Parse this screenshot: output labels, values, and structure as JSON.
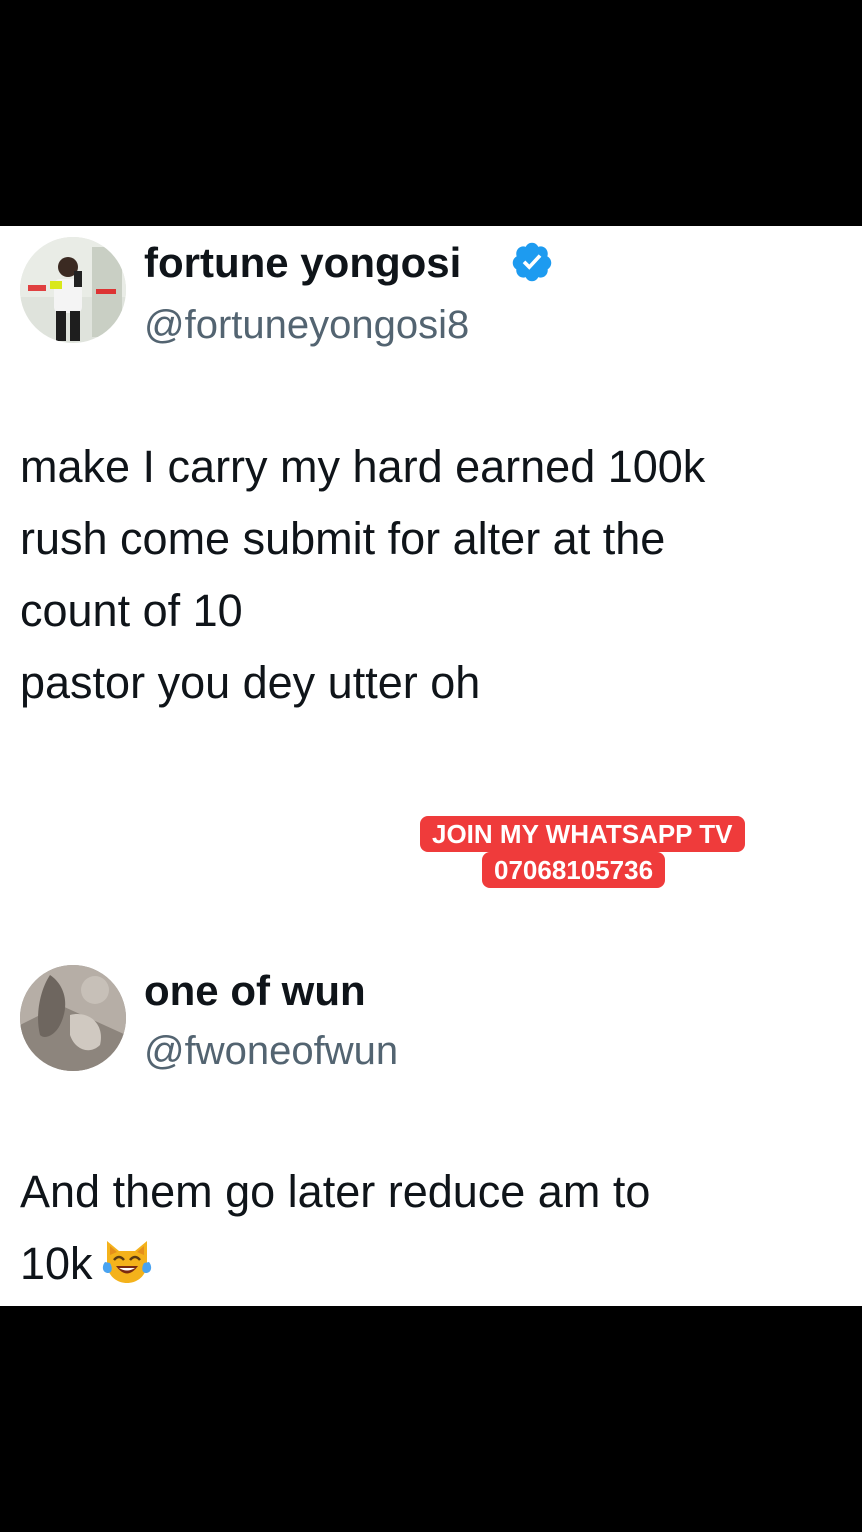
{
  "tweets": [
    {
      "display_name": "fortune yongosi",
      "handle": "@fortuneyongosi8",
      "verified": true,
      "lines": [
        "make I carry my hard earned 100k",
        "rush come submit for alter at the",
        "count of 10",
        "pastor you dey utter oh"
      ]
    },
    {
      "display_name": "one of wun",
      "handle": "@fwoneofwun",
      "verified": false,
      "lines": [
        "And them go later reduce am to",
        "10k"
      ],
      "emoji": "cat-face-with-tears-of-joy"
    }
  ],
  "promo": {
    "line1": "JOIN MY WHATSAPP TV",
    "line2": "07068105736"
  },
  "colors": {
    "verified_blue": "#1d9bf0",
    "promo_red": "#ef3b3b",
    "handle_gray": "#536471",
    "text": "#0f1419"
  }
}
